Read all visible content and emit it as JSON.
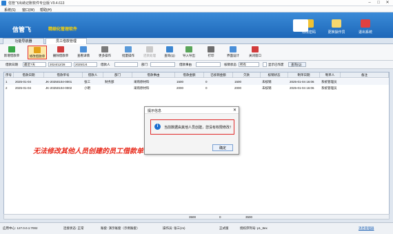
{
  "window": {
    "title": "信管飞出纳记账软件专业版 V9.4.613"
  },
  "menu": [
    "系统(S)",
    "窗口(W)",
    "帮助(H)"
  ],
  "banner": {
    "logo": "信管飞",
    "subtitle": "精细化管理软件",
    "buttons": [
      "修改密码",
      "更换操作员",
      "退出系统"
    ]
  },
  "tabs": [
    "功能导航器",
    "员工借款管理"
  ],
  "toolbar": [
    "新增借款单",
    "修改借款单",
    "删除借款单",
    "查看详情",
    "更多操作",
    "批量操作",
    "还款处理",
    "查询(Q)",
    "审核(V)",
    "导入导出",
    "打印",
    "界面设计",
    "关闭窗口"
  ],
  "filter": {
    "date_label": "借款日期",
    "date_range": "最近7天",
    "from": "2024/12/28",
    "to": "2025/1/4",
    "person_label": "借款人",
    "dept_label": "部门",
    "reason_label": "借款事由",
    "status_label": "核销状态",
    "status_value": "所有",
    "show_voided": "显示已作废",
    "query": "查询(Q)"
  },
  "table": {
    "headers": [
      "序号",
      "借款日期",
      "借款单号",
      "借款人",
      "部门",
      "借款事由",
      "借款金额",
      "已核销金额",
      "欠款",
      "核销状态",
      "制单日期",
      "制单人",
      "备注"
    ],
    "rows": [
      [
        "1",
        "2025-01-04",
        "JK-20250104-0001",
        "张三",
        "财务部",
        "采购原材料",
        "1500",
        "0",
        "1500",
        "未核销",
        "2025-01-04 16:06",
        "系统管理员",
        ""
      ],
      [
        "2",
        "2025-01-04",
        "JK-20250104-0002",
        "小明",
        "",
        "采购原材料",
        "2000",
        "0",
        "2000",
        "未核销",
        "2025-01-04 16:06",
        "系统管理员",
        ""
      ]
    ],
    "totals": [
      "3500",
      "0",
      "3500"
    ]
  },
  "annotation": "无法修改其他人员创建的员工借款单",
  "dialog": {
    "title": "提示信息",
    "message": "当前数据由其他人员创建，您没有权限修改！",
    "ok": "确定"
  },
  "status": {
    "server": "应用中心: 127.0.0.1:7002",
    "conn": "连接状态: 正常",
    "account": "账套: 演示账套（示例账套）",
    "operator": "操作员: 张三(zs)",
    "edition": "正式版",
    "license": "授权序列号: p1_8ex",
    "msg": "消息管理器"
  }
}
